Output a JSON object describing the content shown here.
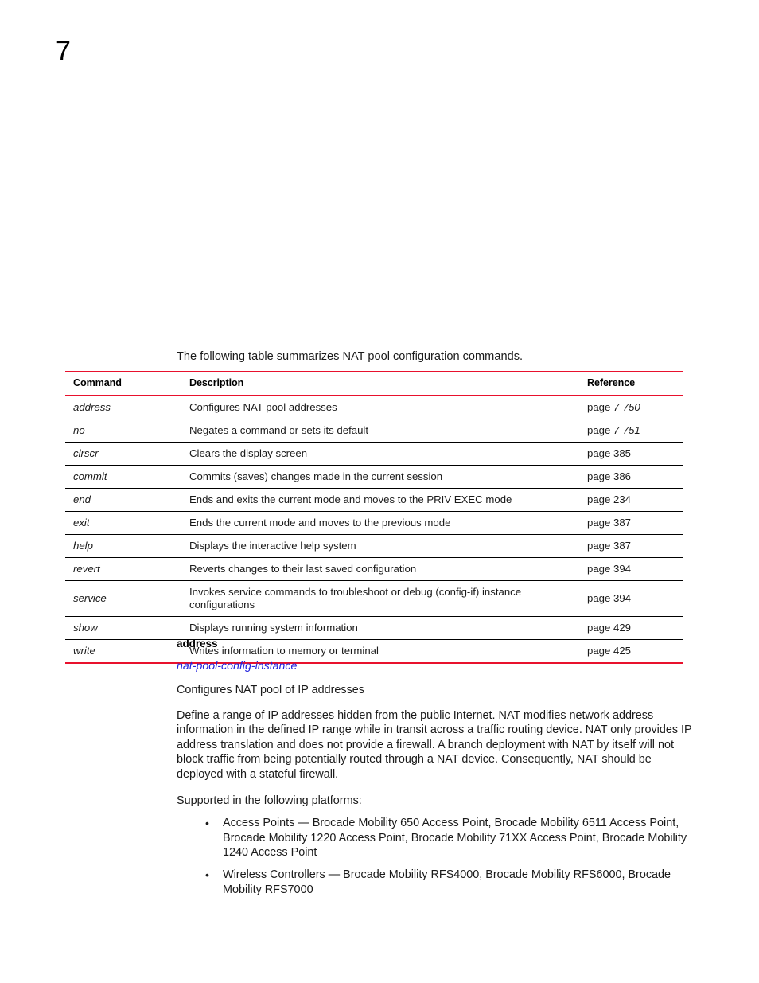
{
  "page": {
    "chapter_number": "7"
  },
  "intro": {
    "text": "The following table summarizes NAT pool configuration commands."
  },
  "table": {
    "headers": [
      "Command",
      "Description",
      "Reference"
    ],
    "rows": [
      {
        "command": "address",
        "description": "Configures NAT pool addresses",
        "ref_prefix": "page ",
        "ref_value": "7-750",
        "ref_italic": true
      },
      {
        "command": "no",
        "description": "Negates a command or sets its default",
        "ref_prefix": "page ",
        "ref_value": "7-751",
        "ref_italic": true
      },
      {
        "command": "clrscr",
        "description": "Clears the display screen",
        "ref_prefix": "page ",
        "ref_value": "385",
        "ref_italic": false
      },
      {
        "command": "commit",
        "description": "Commits (saves) changes made in the current session",
        "ref_prefix": "page ",
        "ref_value": "386",
        "ref_italic": false
      },
      {
        "command": "end",
        "description": "Ends and exits the current mode and moves to the PRIV EXEC mode",
        "ref_prefix": "page ",
        "ref_value": "234",
        "ref_italic": false
      },
      {
        "command": "exit",
        "description": "Ends the current mode and moves to the previous mode",
        "ref_prefix": "page ",
        "ref_value": "387",
        "ref_italic": false
      },
      {
        "command": "help",
        "description": "Displays the interactive help system",
        "ref_prefix": "page ",
        "ref_value": "387",
        "ref_italic": false
      },
      {
        "command": "revert",
        "description": "Reverts changes to their last saved configuration",
        "ref_prefix": "page ",
        "ref_value": "394",
        "ref_italic": false
      },
      {
        "command": "service",
        "description": "Invokes service commands to troubleshoot or debug (config-if) instance configurations",
        "ref_prefix": "page ",
        "ref_value": "394",
        "ref_italic": false
      },
      {
        "command": "show",
        "description": "Displays running system information",
        "ref_prefix": "page ",
        "ref_value": "429",
        "ref_italic": false
      },
      {
        "command": "write",
        "description": "Writes information to memory or terminal",
        "ref_prefix": "page ",
        "ref_value": "425",
        "ref_italic": false
      }
    ]
  },
  "detail": {
    "heading": "address",
    "mode": "nat-pool-config-instance",
    "summary": "Configures NAT pool of IP addresses",
    "description": "Define a range of IP addresses hidden from the public Internet. NAT modifies network address information in the defined IP range while in transit across a traffic routing device. NAT only provides IP address translation and does not provide a firewall. A branch deployment with NAT by itself will not block traffic from being potentially routed through a NAT device. Consequently, NAT should be deployed with a stateful firewall.",
    "supported_label": "Supported in the following platforms:",
    "platforms": [
      "Access Points — Brocade Mobility 650 Access Point, Brocade Mobility 6511 Access Point, Brocade Mobility 1220 Access Point, Brocade Mobility 71XX Access Point, Brocade Mobility 1240 Access Point",
      "Wireless Controllers — Brocade Mobility RFS4000, Brocade Mobility RFS6000, Brocade Mobility RFS7000"
    ],
    "bullet_glyph": "•"
  },
  "colors": {
    "rule_red": "#e8112d",
    "link_blue": "#2222dd",
    "body_text": "#1a1a1a"
  }
}
